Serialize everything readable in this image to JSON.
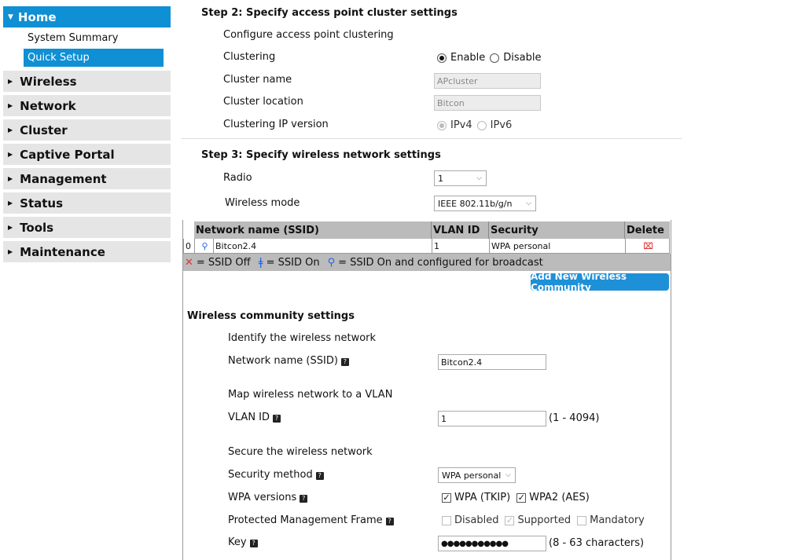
{
  "sidebar": {
    "home": "Home",
    "sub_items": [
      "System Summary",
      "Quick Setup"
    ],
    "items": [
      "Wireless",
      "Network",
      "Cluster",
      "Captive Portal",
      "Management",
      "Status",
      "Tools",
      "Maintenance"
    ]
  },
  "step2": {
    "title": "Step 2: Specify access point cluster settings",
    "configure_label": "Configure access point clustering",
    "clustering_label": "Clustering",
    "enable": "Enable",
    "disable": "Disable",
    "cluster_name_label": "Cluster name",
    "cluster_name_value": "APcluster",
    "cluster_location_label": "Cluster location",
    "cluster_location_value": "Bitcon",
    "ip_version_label": "Clustering IP version",
    "ipv4": "IPv4",
    "ipv6": "IPv6"
  },
  "step3": {
    "title": "Step 3: Specify wireless network settings",
    "radio_label": "Radio",
    "radio_value": "1",
    "mode_label": "Wireless mode",
    "mode_value": "IEEE 802.11b/g/n"
  },
  "table": {
    "headers": [
      "Network name (SSID)",
      "VLAN ID",
      "Security",
      "Delete"
    ],
    "rows": [
      {
        "index": "0",
        "ssid": "Bitcon2.4",
        "vlan": "1",
        "security": "WPA personal"
      }
    ],
    "legend_off": "= SSID Off",
    "legend_on": "= SSID On",
    "legend_broadcast": "= SSID On and configured for broadcast"
  },
  "add_button": "Add New Wireless Community",
  "community": {
    "title": "Wireless community settings",
    "identify_label": "Identify the wireless network",
    "ssid_label": "Network name (SSID)",
    "ssid_value": "Bitcon2.4",
    "map_label": "Map wireless network to a VLAN",
    "vlan_label": "VLAN ID",
    "vlan_value": "1",
    "vlan_range": "(1 - 4094)",
    "secure_label": "Secure the wireless network",
    "security_method_label": "Security method",
    "security_method_value": "WPA personal",
    "wpa_versions_label": "WPA versions",
    "wpa_tkip": "WPA (TKIP)",
    "wpa2_aes": "WPA2 (AES)",
    "pmf_label": "Protected Management Frame",
    "pmf_disabled": "Disabled",
    "pmf_supported": "Supported",
    "pmf_mandatory": "Mandatory",
    "key_label": "Key",
    "key_value": "●●●●●●●●●●●",
    "key_range": "(8 - 63 characters)"
  },
  "colors": {
    "accent": "#0f8fd4",
    "nav_bg": "#e5e5e5",
    "table_head": "#bbbbbb"
  },
  "icons": [
    "caret-down-icon",
    "caret-right-icon",
    "antenna-icon",
    "delete-icon",
    "help-icon",
    "chevron-down-icon"
  ]
}
